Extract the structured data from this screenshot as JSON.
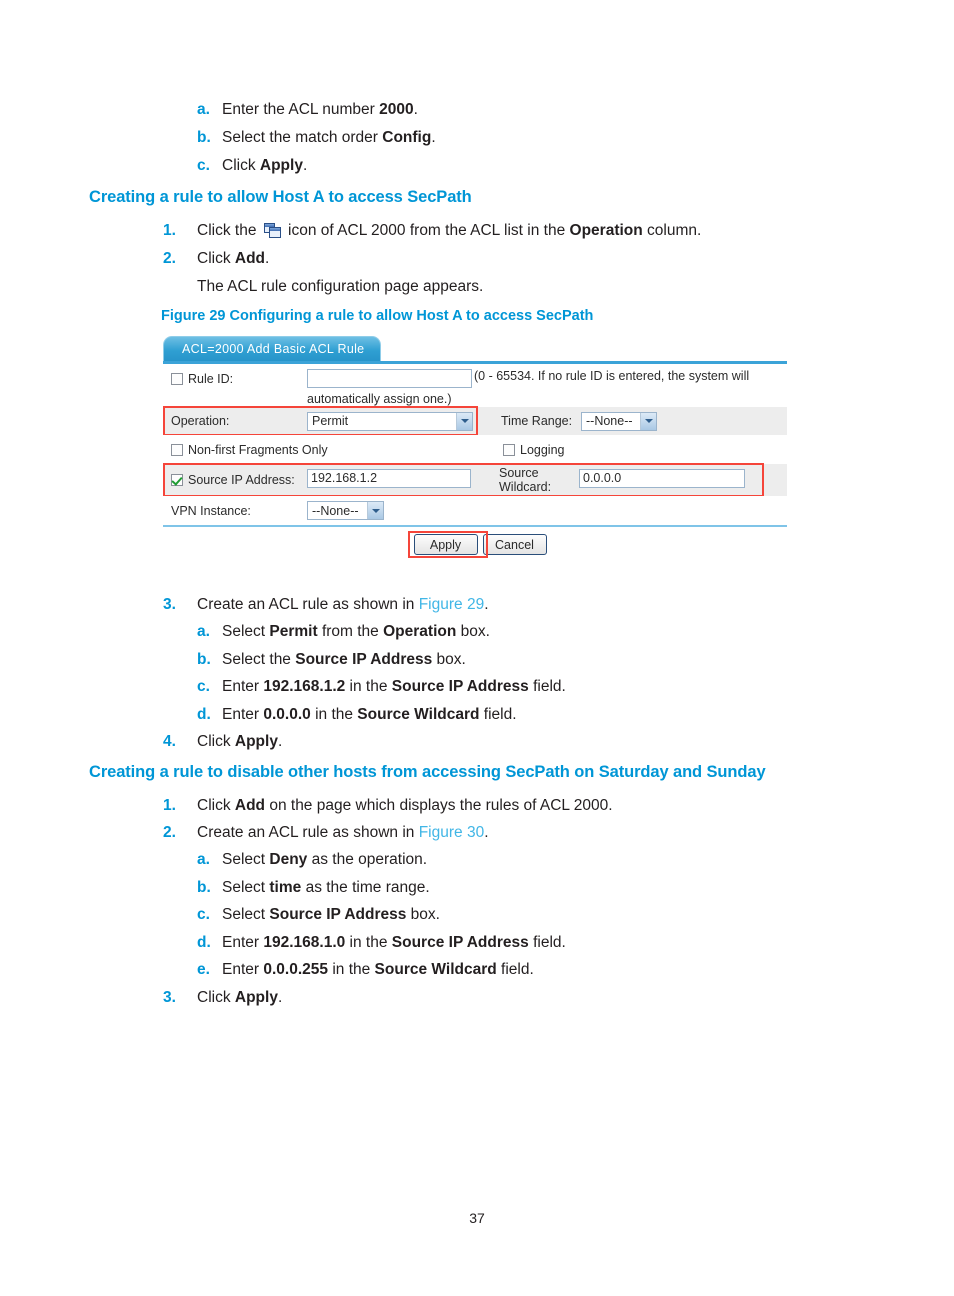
{
  "page_number": "37",
  "intro_steps": [
    {
      "marker": "a.",
      "pre": "Enter the ACL number ",
      "bold": "2000",
      "post": "."
    },
    {
      "marker": "b.",
      "pre": "Select the match order ",
      "bold": "Config",
      "post": "."
    },
    {
      "marker": "c.",
      "pre": "Click ",
      "bold": "Apply",
      "post": "."
    }
  ],
  "section1": {
    "heading": "Creating a rule to allow Host A to access SecPath",
    "step1": {
      "marker": "1.",
      "pre": "Click the ",
      "icon": "cascade-windows-icon",
      "mid": " icon of ACL 2000 from the ACL list in the ",
      "bold": "Operation",
      "post": " column."
    },
    "step2": {
      "marker": "2.",
      "pre": "Click ",
      "bold": "Add",
      "post": "."
    },
    "step2_note": "The ACL rule configuration page appears.",
    "figure_caption": "Figure 29 Configuring a rule to allow Host A to access SecPath",
    "step3": {
      "marker": "3.",
      "pre": "Create an ACL rule as shown in ",
      "link": "Figure 29",
      "post": "."
    },
    "step3_sub": [
      {
        "marker": "a.",
        "parts": [
          {
            "t": "Select ",
            "b": false
          },
          {
            "t": "Permit",
            "b": true
          },
          {
            "t": " from the ",
            "b": false
          },
          {
            "t": "Operation",
            "b": true
          },
          {
            "t": " box.",
            "b": false
          }
        ]
      },
      {
        "marker": "b.",
        "parts": [
          {
            "t": "Select the ",
            "b": false
          },
          {
            "t": "Source IP Address",
            "b": true
          },
          {
            "t": " box.",
            "b": false
          }
        ]
      },
      {
        "marker": "c.",
        "parts": [
          {
            "t": "Enter ",
            "b": false
          },
          {
            "t": "192.168.1.2",
            "b": true
          },
          {
            "t": " in the ",
            "b": false
          },
          {
            "t": "Source IP Address",
            "b": true
          },
          {
            "t": " field.",
            "b": false
          }
        ]
      },
      {
        "marker": "d.",
        "parts": [
          {
            "t": "Enter ",
            "b": false
          },
          {
            "t": "0.0.0.0",
            "b": true
          },
          {
            "t": " in the ",
            "b": false
          },
          {
            "t": "Source Wildcard",
            "b": true
          },
          {
            "t": " field.",
            "b": false
          }
        ]
      }
    ],
    "step4": {
      "marker": "4.",
      "pre": "Click ",
      "bold": "Apply",
      "post": "."
    }
  },
  "acl_form": {
    "tab_label": "ACL=2000 Add Basic ACL Rule",
    "rule_id": {
      "label": "Rule ID:",
      "checked": false,
      "value": "",
      "hint_line1": "(0 - 65534. If no rule ID is entered, the system will",
      "hint_line2": "automatically assign one.)"
    },
    "operation": {
      "label": "Operation:",
      "value": "Permit"
    },
    "time_range": {
      "label": "Time Range:",
      "value": "--None--"
    },
    "non_first_fragments": {
      "label": "Non-first Fragments Only",
      "checked": false
    },
    "logging": {
      "label": "Logging",
      "checked": false
    },
    "source_ip": {
      "label": "Source IP Address:",
      "checked": true,
      "value": "192.168.1.2"
    },
    "source_wildcard": {
      "label_line1": "Source",
      "label_line2": "Wildcard:",
      "value": "0.0.0.0"
    },
    "vpn_instance": {
      "label": "VPN Instance:",
      "value": "--None--"
    },
    "apply_button": "Apply",
    "cancel_button": "Cancel",
    "highlight_color": "#f5453a",
    "tab_color": "#2f9fd2"
  },
  "section2": {
    "heading": "Creating a rule to disable other hosts from accessing SecPath on Saturday and Sunday",
    "step1": {
      "marker": "1.",
      "parts": [
        {
          "t": "Click ",
          "b": false
        },
        {
          "t": "Add",
          "b": true
        },
        {
          "t": " on the page which displays the rules of ACL 2000.",
          "b": false
        }
      ]
    },
    "step2": {
      "marker": "2.",
      "pre": "Create an ACL rule as shown in ",
      "link": "Figure 30",
      "post": "."
    },
    "step2_sub": [
      {
        "marker": "a.",
        "parts": [
          {
            "t": "Select ",
            "b": false
          },
          {
            "t": "Deny",
            "b": true
          },
          {
            "t": " as the operation.",
            "b": false
          }
        ]
      },
      {
        "marker": "b.",
        "parts": [
          {
            "t": "Select ",
            "b": false
          },
          {
            "t": "time",
            "b": true
          },
          {
            "t": " as the time range.",
            "b": false
          }
        ]
      },
      {
        "marker": "c.",
        "parts": [
          {
            "t": "Select ",
            "b": false
          },
          {
            "t": "Source IP Address",
            "b": true
          },
          {
            "t": " box.",
            "b": false
          }
        ]
      },
      {
        "marker": "d.",
        "parts": [
          {
            "t": "Enter ",
            "b": false
          },
          {
            "t": "192.168.1.0",
            "b": true
          },
          {
            "t": " in the ",
            "b": false
          },
          {
            "t": "Source IP Address",
            "b": true
          },
          {
            "t": " field.",
            "b": false
          }
        ]
      },
      {
        "marker": "e.",
        "parts": [
          {
            "t": "Enter ",
            "b": false
          },
          {
            "t": "0.0.0.255",
            "b": true
          },
          {
            "t": " in the ",
            "b": false
          },
          {
            "t": "Source Wildcard",
            "b": true
          },
          {
            "t": " field.",
            "b": false
          }
        ]
      }
    ],
    "step3": {
      "marker": "3.",
      "pre": "Click ",
      "bold": "Apply",
      "post": "."
    }
  }
}
